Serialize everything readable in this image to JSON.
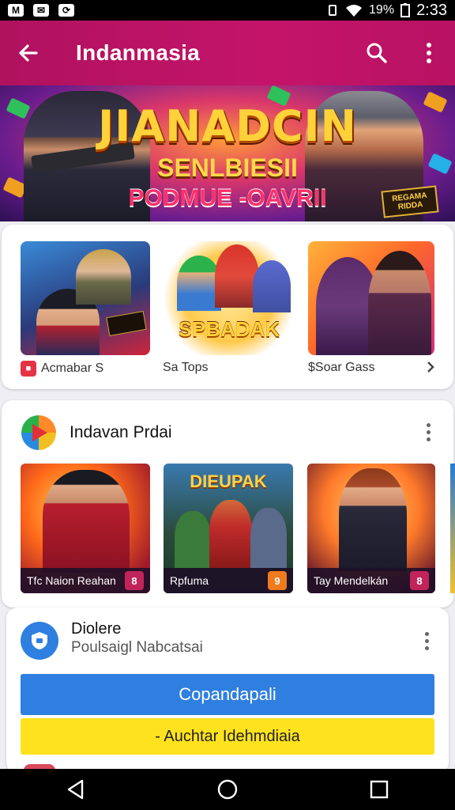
{
  "status_bar": {
    "battery": "19%",
    "time": "2:33"
  },
  "app_bar": {
    "title": "Indanmasia",
    "back_icon": "arrow-left-icon",
    "search_icon": "search-icon",
    "menu_icon": "more-vert-icon"
  },
  "hero": {
    "title": "JIANADCIN",
    "subtitle": "SENLBIESII",
    "tagline": "PODMUE -OAVRII",
    "badge": "REGAMA RIDDA"
  },
  "featured": {
    "items": [
      {
        "label": "Acmabar S",
        "icon": "app-icon"
      },
      {
        "label": "Sa Tops",
        "art_text": "SPBADAK"
      },
      {
        "label": "$Soar Gass"
      }
    ],
    "more_icon": "chevron-right-icon"
  },
  "section2": {
    "title": "Indavan Prdai",
    "logo_icon": "play-logo-icon",
    "menu_icon": "more-vert-icon",
    "games": [
      {
        "caption": "Tfc Naion Reahan",
        "badge": "8",
        "badge_color": "#c0245a"
      },
      {
        "caption": "Rpfuma",
        "badge": "9",
        "badge_color": "#f07a1e",
        "art_text": "DIEUPAK"
      },
      {
        "caption": "Tay Mendelkán",
        "badge": "8",
        "badge_color": "#c0245a"
      }
    ]
  },
  "section3": {
    "title": "Diolere",
    "subtitle": "Poulsaigl Nabcatsai",
    "app_icon": "app-shield-icon",
    "menu_icon": "more-vert-icon",
    "primary_button": "Copandapali",
    "secondary_button": "- Auchtar Idehmdiaia"
  },
  "nav_bar": {
    "back_icon": "triangle-back-icon",
    "home_icon": "circle-home-icon",
    "recents_icon": "square-recents-icon"
  }
}
